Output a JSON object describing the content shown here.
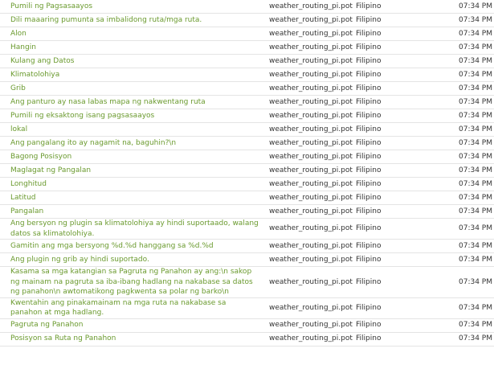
{
  "rows": [
    {
      "string": "Pumili ng Pagsasaayos",
      "file": "weather_routing_pi.pot",
      "language": "Filipino",
      "time": "07:34 PM"
    },
    {
      "string": "Dili maaaring pumunta sa imbalidong ruta/mga ruta.",
      "file": "weather_routing_pi.pot",
      "language": "Filipino",
      "time": "07:34 PM"
    },
    {
      "string": "Alon",
      "file": "weather_routing_pi.pot",
      "language": "Filipino",
      "time": "07:34 PM"
    },
    {
      "string": "Hangin",
      "file": "weather_routing_pi.pot",
      "language": "Filipino",
      "time": "07:34 PM"
    },
    {
      "string": "Kulang ang Datos",
      "file": "weather_routing_pi.pot",
      "language": "Filipino",
      "time": "07:34 PM"
    },
    {
      "string": "Klimatolohiya",
      "file": "weather_routing_pi.pot",
      "language": "Filipino",
      "time": "07:34 PM"
    },
    {
      "string": "Grib",
      "file": "weather_routing_pi.pot",
      "language": "Filipino",
      "time": "07:34 PM"
    },
    {
      "string": "Ang panturo ay nasa labas mapa ng nakwentang ruta",
      "file": "weather_routing_pi.pot",
      "language": "Filipino",
      "time": "07:34 PM"
    },
    {
      "string": "Pumili ng eksaktong isang pagsasaayos",
      "file": "weather_routing_pi.pot",
      "language": "Filipino",
      "time": "07:34 PM"
    },
    {
      "string": "lokal",
      "file": "weather_routing_pi.pot",
      "language": "Filipino",
      "time": "07:34 PM"
    },
    {
      "string": "Ang pangalang ito ay nagamit na, baguhin?\\n",
      "file": "weather_routing_pi.pot",
      "language": "Filipino",
      "time": "07:34 PM"
    },
    {
      "string": "Bagong Posisyon",
      "file": "weather_routing_pi.pot",
      "language": "Filipino",
      "time": "07:34 PM"
    },
    {
      "string": "Maglagat ng Pangalan",
      "file": "weather_routing_pi.pot",
      "language": "Filipino",
      "time": "07:34 PM"
    },
    {
      "string": "Longhitud",
      "file": "weather_routing_pi.pot",
      "language": "Filipino",
      "time": "07:34 PM"
    },
    {
      "string": "Latitud",
      "file": "weather_routing_pi.pot",
      "language": "Filipino",
      "time": "07:34 PM"
    },
    {
      "string": "Pangalan",
      "file": "weather_routing_pi.pot",
      "language": "Filipino",
      "time": "07:34 PM"
    },
    {
      "string": "Ang bersyon ng plugin sa klimatolohiya ay hindi suportaado, walang datos sa klimatolohiya.",
      "file": "weather_routing_pi.pot",
      "language": "Filipino",
      "time": "07:34 PM"
    },
    {
      "string": "Gamitin ang mga bersyong %d.%d hanggang sa %d.%d",
      "file": "weather_routing_pi.pot",
      "language": "Filipino",
      "time": "07:34 PM"
    },
    {
      "string": "Ang plugin ng grib ay hindi suportado.",
      "file": "weather_routing_pi.pot",
      "language": "Filipino",
      "time": "07:34 PM"
    },
    {
      "string": "Kasama sa mga katangian sa Pagruta ng Panahon ay ang:\\n sakop ng mainam na pagruta sa iba-ibang hadlang na nakabase sa datos ng panahon\\n awtomatikong pagkwenta sa polar ng barko\\n",
      "file": "weather_routing_pi.pot",
      "language": "Filipino",
      "time": "07:34 PM"
    },
    {
      "string": "Kwentahin ang pinakamainam na mga ruta na nakabase sa panahon at mga hadlang.",
      "file": "weather_routing_pi.pot",
      "language": "Filipino",
      "time": "07:34 PM"
    },
    {
      "string": "Pagruta ng Panahon",
      "file": "weather_routing_pi.pot",
      "language": "Filipino",
      "time": "07:34 PM"
    },
    {
      "string": "Posisyon sa Ruta ng Panahon",
      "file": "weather_routing_pi.pot",
      "language": "Filipino",
      "time": "07:34 PM"
    }
  ],
  "colors": {
    "string_link": "#6a9a2e",
    "text": "#333333",
    "row_divider": "#e4e4e4"
  }
}
